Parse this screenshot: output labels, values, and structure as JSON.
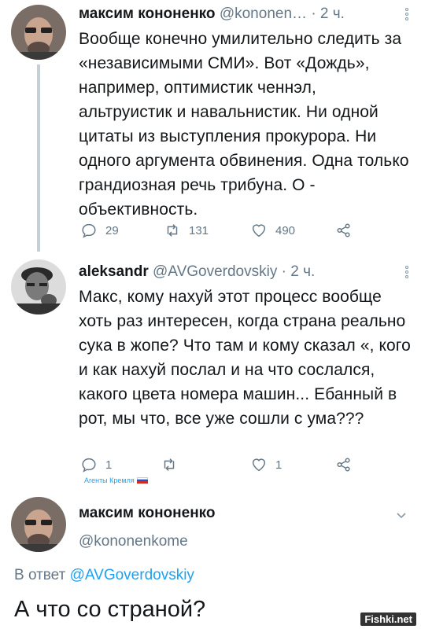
{
  "tweet1": {
    "author_name": "максим кононенко",
    "author_handle": "@kononen…",
    "time": "· 2 ч.",
    "text": "Вообще конечно умилительно следить за «независимыми СМИ». Вот «Дождь», например, оптимистик ченнэл, альтруистик и навальнистик. Ни одной цитаты из выступления прокурора. Ни одного аргумента обвинения. Одна только грандиозная речь трибуна. О - объективность.",
    "replies": "29",
    "retweets": "131",
    "likes": "490"
  },
  "tweet2": {
    "author_name": "aleksandr",
    "author_handle": "@AVGoverdovskiy",
    "time": "· 2 ч.",
    "text": "Макс, кому нахуй этот процесс вообще хоть раз интересен, когда страна реально сука в жопе? Что там и кому сказал «, кого и как нахуй послал и на что сослался, какого цвета номера машин... Ебанный в рот, мы что, все уже сошли с ума???",
    "replies": "1",
    "retweets": "",
    "likes": "1",
    "tag": "Агенты Кремля"
  },
  "tweet3": {
    "author_name": "максим кононенко",
    "author_handle": "@kononenkome",
    "reply_prefix": "В ответ",
    "reply_mention": "@AVGoverdovskiy",
    "text": "А что со страной?"
  },
  "watermark": "Fishki.net",
  "colors": {
    "text": "#14171a",
    "secondary": "#657786",
    "accent": "#1da1f2",
    "thread_line": "#c4cfd6"
  },
  "icons": [
    "reply-icon",
    "retweet-icon",
    "like-icon",
    "share-icon",
    "more-icon",
    "chevron-down-icon"
  ]
}
